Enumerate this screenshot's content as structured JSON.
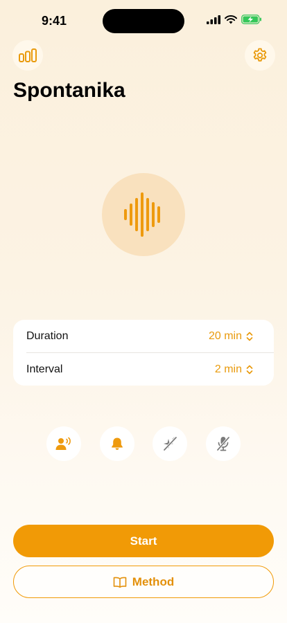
{
  "status_bar": {
    "time": "9:41"
  },
  "header": {
    "title": "Spontanika"
  },
  "settings": {
    "duration": {
      "label": "Duration",
      "value": "20 min"
    },
    "interval": {
      "label": "Interval",
      "value": "2 min"
    }
  },
  "toggles": [
    {
      "icon": "person-speaking-icon"
    },
    {
      "icon": "bell-icon"
    },
    {
      "icon": "sparkles-off-icon"
    },
    {
      "icon": "microphone-off-icon"
    }
  ],
  "actions": {
    "start_label": "Start",
    "method_label": "Method"
  },
  "colors": {
    "accent": "#F19A06",
    "accent_light": "#F9E1BE",
    "background": "#FBF0DC"
  }
}
